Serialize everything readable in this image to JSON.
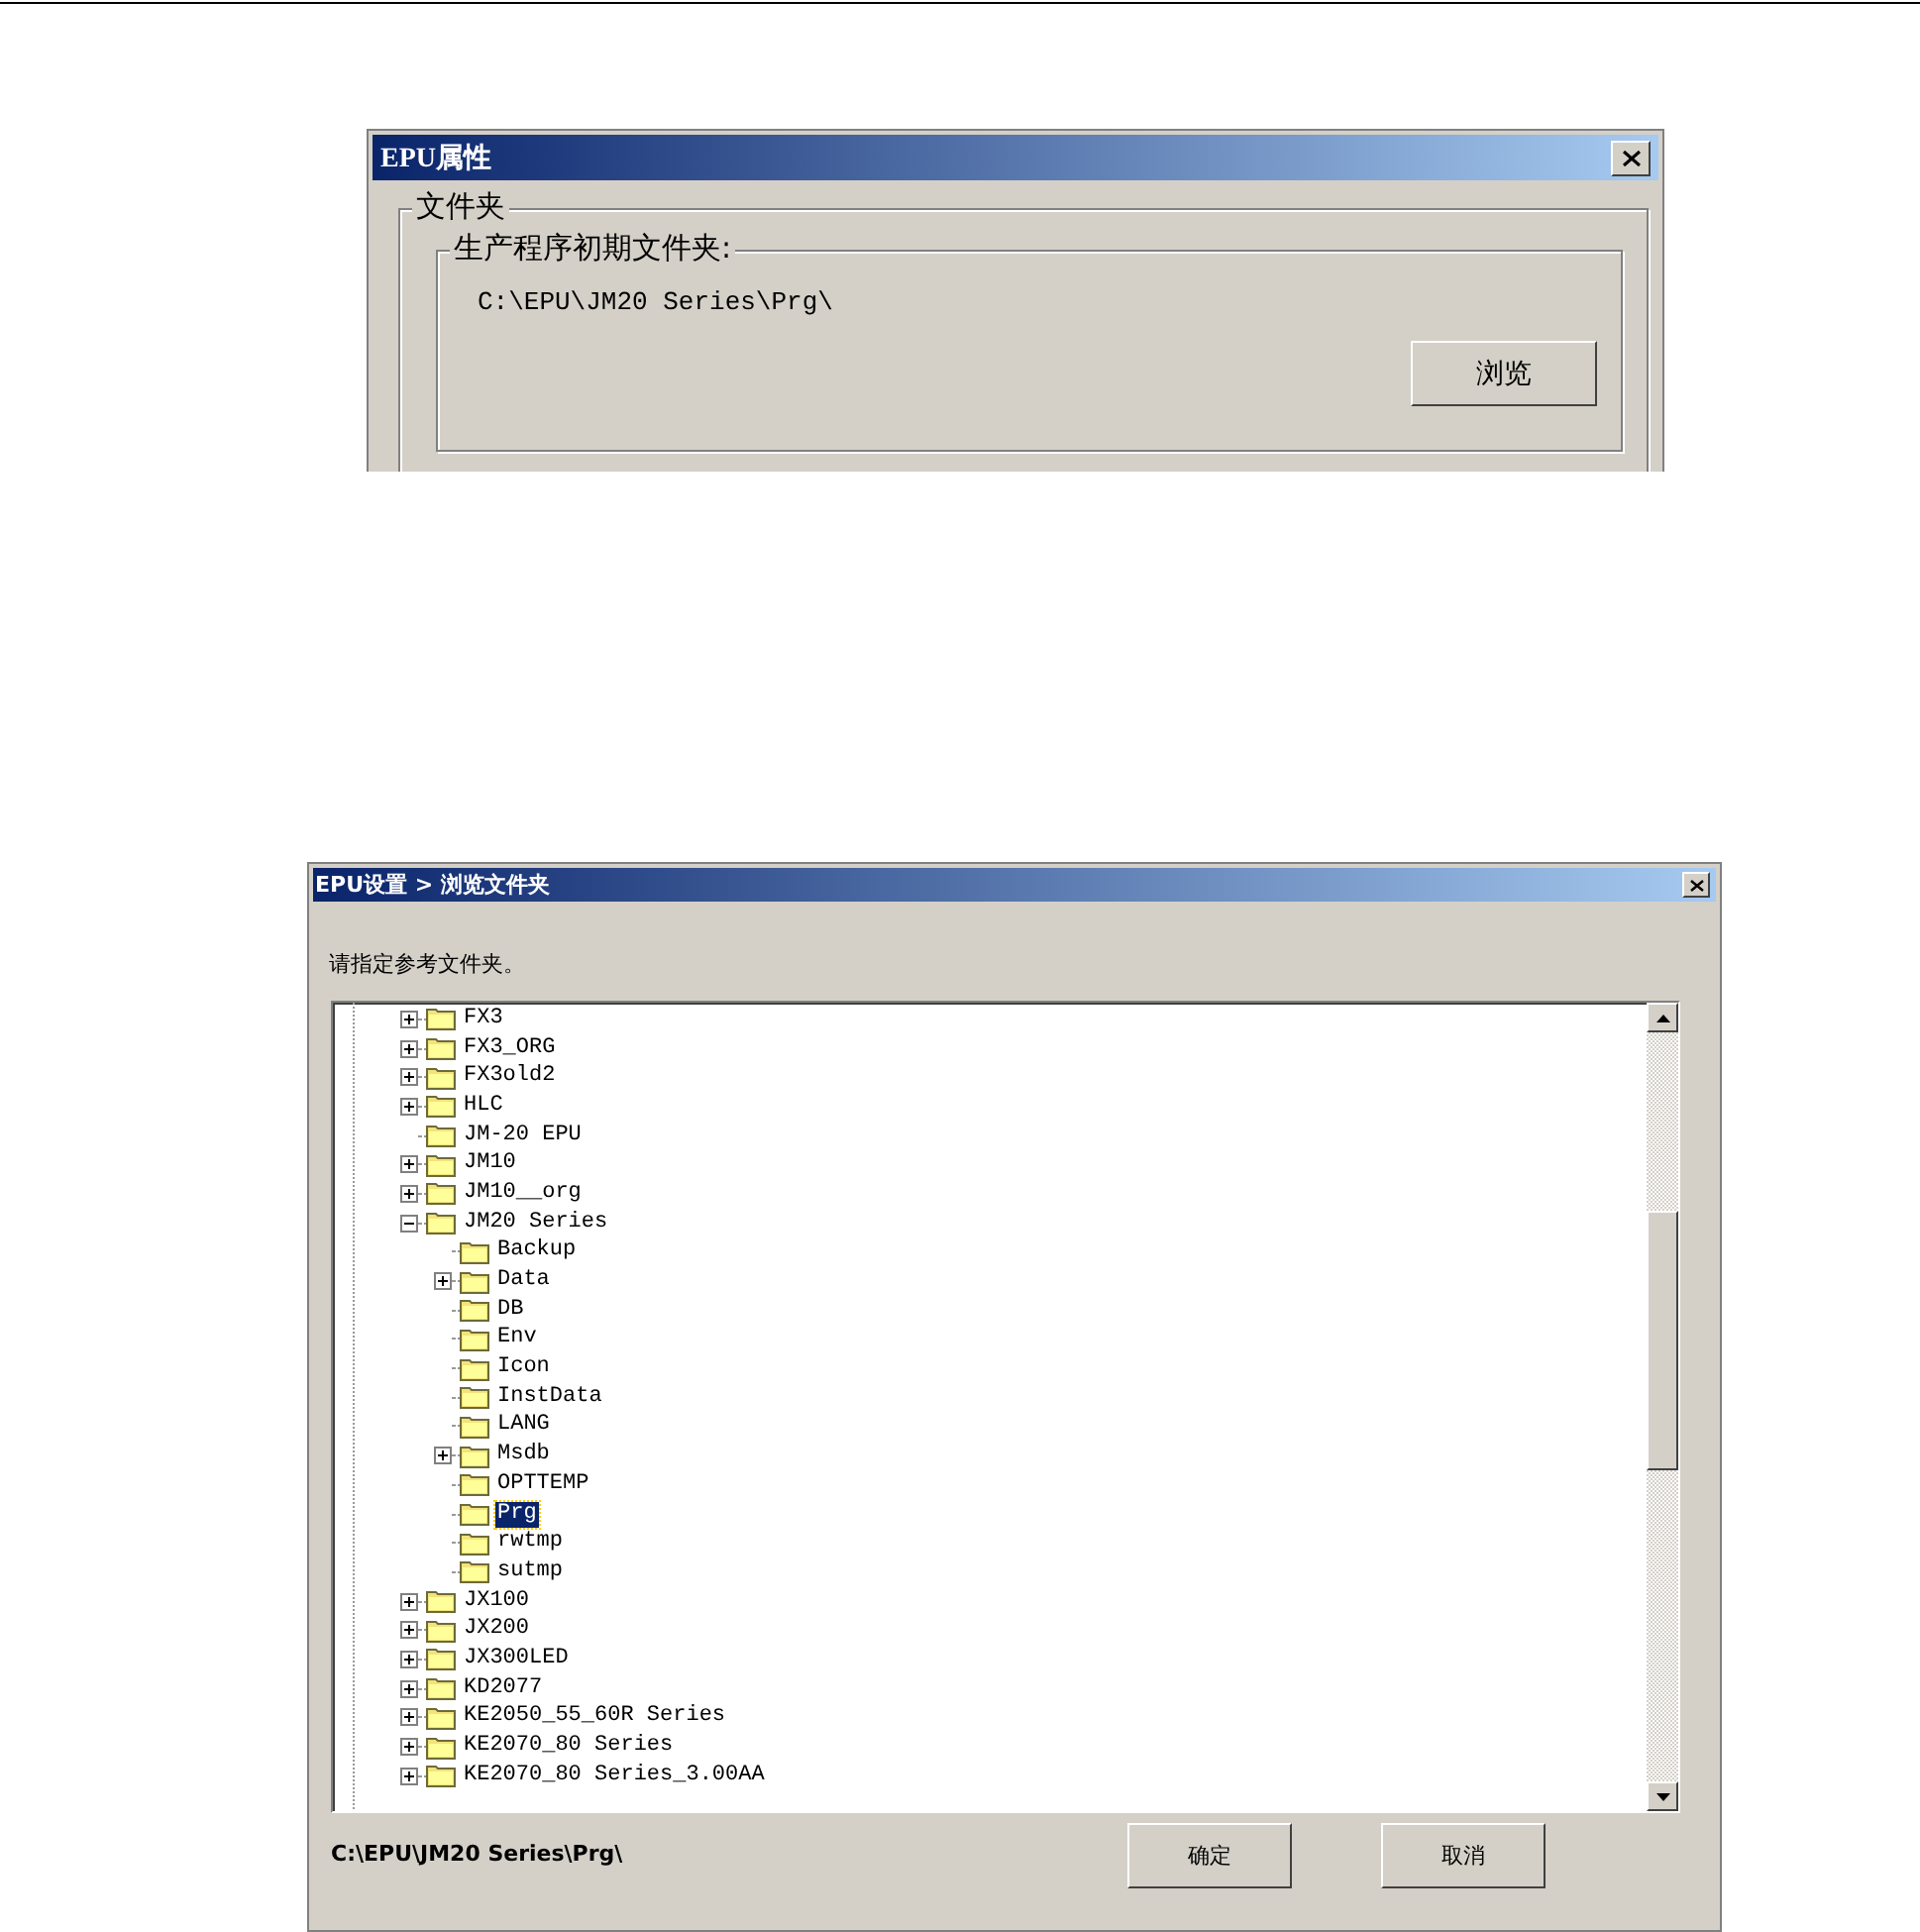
{
  "properties_dialog": {
    "title": "EPU属性",
    "group": "文件夹",
    "subgroup": "生产程序初期文件夹:",
    "path": "C:\\EPU\\JM20 Series\\Prg\\",
    "browse_button": "浏览"
  },
  "browse_dialog": {
    "title": "EPU设置 > 浏览文件夹",
    "prompt": "请指定参考文件夹。",
    "tree": [
      {
        "name": "FX3",
        "kind": "collapsed",
        "selected": false
      },
      {
        "name": "FX3_ORG",
        "kind": "collapsed",
        "selected": false
      },
      {
        "name": "FX3old2",
        "kind": "collapsed",
        "selected": false
      },
      {
        "name": "HLC",
        "kind": "collapsed",
        "selected": false
      },
      {
        "name": "JM-20 EPU",
        "kind": "leaf",
        "selected": false
      },
      {
        "name": "JM10",
        "kind": "collapsed",
        "selected": false
      },
      {
        "name": "JM10__org",
        "kind": "collapsed",
        "selected": false
      },
      {
        "name": "JM20 Series",
        "kind": "expanded",
        "selected": false,
        "children": [
          {
            "name": "Backup",
            "kind": "leaf",
            "selected": false
          },
          {
            "name": "Data",
            "kind": "collapsed",
            "selected": false
          },
          {
            "name": "DB",
            "kind": "leaf",
            "selected": false
          },
          {
            "name": "Env",
            "kind": "leaf",
            "selected": false
          },
          {
            "name": "Icon",
            "kind": "leaf",
            "selected": false
          },
          {
            "name": "InstData",
            "kind": "leaf",
            "selected": false
          },
          {
            "name": "LANG",
            "kind": "leaf",
            "selected": false
          },
          {
            "name": "Msdb",
            "kind": "collapsed",
            "selected": false
          },
          {
            "name": "OPTTEMP",
            "kind": "leaf",
            "selected": false
          },
          {
            "name": "Prg",
            "kind": "leaf",
            "selected": true
          },
          {
            "name": "rwtmp",
            "kind": "leaf",
            "selected": false
          },
          {
            "name": "sutmp",
            "kind": "leaf",
            "selected": false
          }
        ]
      },
      {
        "name": "JX100",
        "kind": "collapsed",
        "selected": false
      },
      {
        "name": "JX200",
        "kind": "collapsed",
        "selected": false
      },
      {
        "name": "JX300LED",
        "kind": "collapsed",
        "selected": false
      },
      {
        "name": "KD2077",
        "kind": "collapsed",
        "selected": false
      },
      {
        "name": "KE2050_55_60R Series",
        "kind": "collapsed",
        "selected": false
      },
      {
        "name": "KE2070_80 Series",
        "kind": "collapsed",
        "selected": false
      },
      {
        "name": "KE2070_80 Series_3.00AA",
        "kind": "collapsed",
        "selected": false
      }
    ],
    "selected_path": "C:\\EPU\\JM20 Series\\Prg\\",
    "ok_button": "确定",
    "cancel_button": "取消"
  }
}
